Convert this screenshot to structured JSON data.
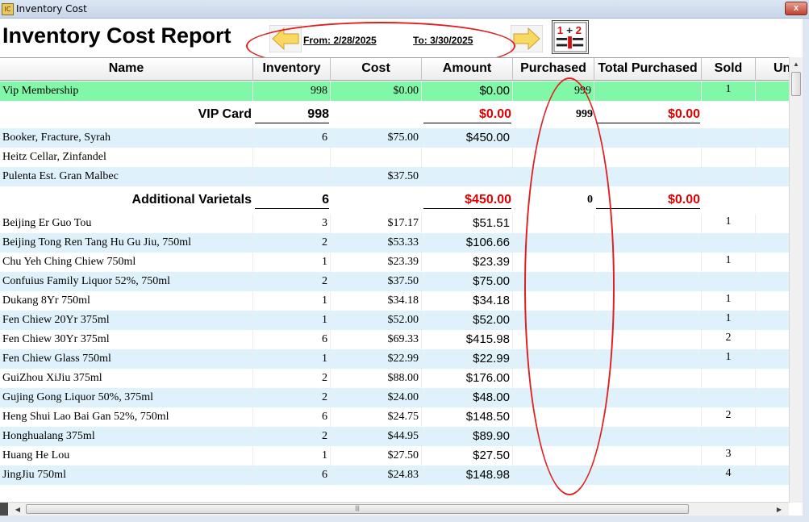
{
  "window": {
    "title": "Inventory Cost",
    "close_label": "x",
    "app_icon_label": "IC"
  },
  "header": {
    "report_title": "Inventory Cost Report",
    "from_label": "From: 2/28/2025",
    "to_label": "To: 3/30/2025",
    "report_icon": "calculator-report-icon"
  },
  "colors": {
    "green_row": "#80f8a8",
    "blue_row": "#dff2fc",
    "red_total": "#e00000",
    "annotation": "#e02020"
  },
  "columns": [
    "Name",
    "Inventory",
    "Cost",
    "Amount",
    "Purchased",
    "Total Purchased",
    "Sold",
    "Un"
  ],
  "rows": [
    {
      "type": "item",
      "style": "green",
      "name": "Vip Membership",
      "inventory": "998",
      "cost": "$0.00",
      "amount": "$0.00",
      "purchased": "999",
      "total_purchased": "",
      "sold": "1"
    },
    {
      "type": "subtotal",
      "name": "VIP Card",
      "inventory": "998",
      "amount": "$0.00",
      "purchased": "999",
      "total_purchased": "$0.00"
    },
    {
      "type": "item",
      "style": "blue",
      "name": "Booker, Fracture, Syrah",
      "inventory": "6",
      "cost": "$75.00",
      "amount": "$450.00",
      "purchased": "",
      "total_purchased": "",
      "sold": ""
    },
    {
      "type": "item",
      "style": "white",
      "name": "Heitz Cellar, Zinfandel",
      "inventory": "",
      "cost": "",
      "amount": "",
      "purchased": "",
      "total_purchased": "",
      "sold": ""
    },
    {
      "type": "item",
      "style": "blue",
      "name": "Pulenta Est. Gran Malbec",
      "inventory": "",
      "cost": "$37.50",
      "amount": "",
      "purchased": "",
      "total_purchased": "",
      "sold": ""
    },
    {
      "type": "subtotal",
      "name": "Additional Varietals",
      "inventory": "6",
      "amount": "$450.00",
      "purchased": "0",
      "total_purchased": "$0.00"
    },
    {
      "type": "item",
      "style": "white",
      "name": "Beijing Er Guo Tou",
      "inventory": "3",
      "cost": "$17.17",
      "amount": "$51.51",
      "purchased": "",
      "total_purchased": "",
      "sold": "1"
    },
    {
      "type": "item",
      "style": "blue",
      "name": "Beijing Tong Ren Tang Hu Gu Jiu, 750ml",
      "inventory": "2",
      "cost": "$53.33",
      "amount": "$106.66",
      "purchased": "",
      "total_purchased": "",
      "sold": ""
    },
    {
      "type": "item",
      "style": "white",
      "name": "Chu Yeh Ching Chiew 750ml",
      "inventory": "1",
      "cost": "$23.39",
      "amount": "$23.39",
      "purchased": "",
      "total_purchased": "",
      "sold": "1"
    },
    {
      "type": "item",
      "style": "blue",
      "name": "Confuius Family Liquor 52%, 750ml",
      "inventory": "2",
      "cost": "$37.50",
      "amount": "$75.00",
      "purchased": "",
      "total_purchased": "",
      "sold": ""
    },
    {
      "type": "item",
      "style": "white",
      "name": "Dukang 8Yr 750ml",
      "inventory": "1",
      "cost": "$34.18",
      "amount": "$34.18",
      "purchased": "",
      "total_purchased": "",
      "sold": "1"
    },
    {
      "type": "item",
      "style": "blue",
      "name": "Fen Chiew 20Yr 375ml",
      "inventory": "1",
      "cost": "$52.00",
      "amount": "$52.00",
      "purchased": "",
      "total_purchased": "",
      "sold": "1"
    },
    {
      "type": "item",
      "style": "white",
      "name": "Fen Chiew 30Yr 375ml",
      "inventory": "6",
      "cost": "$69.33",
      "amount": "$415.98",
      "purchased": "",
      "total_purchased": "",
      "sold": "2"
    },
    {
      "type": "item",
      "style": "blue",
      "name": "Fen Chiew Glass 750ml",
      "inventory": "1",
      "cost": "$22.99",
      "amount": "$22.99",
      "purchased": "",
      "total_purchased": "",
      "sold": "1"
    },
    {
      "type": "item",
      "style": "white",
      "name": "GuiZhou XiJiu 375ml",
      "inventory": "2",
      "cost": "$88.00",
      "amount": "$176.00",
      "purchased": "",
      "total_purchased": "",
      "sold": ""
    },
    {
      "type": "item",
      "style": "blue",
      "name": "Gujing Gong Liquor 50%, 375ml",
      "inventory": "2",
      "cost": "$24.00",
      "amount": "$48.00",
      "purchased": "",
      "total_purchased": "",
      "sold": ""
    },
    {
      "type": "item",
      "style": "white",
      "name": "Heng Shui Lao Bai Gan 52%, 750ml",
      "inventory": "6",
      "cost": "$24.75",
      "amount": "$148.50",
      "purchased": "",
      "total_purchased": "",
      "sold": "2"
    },
    {
      "type": "item",
      "style": "blue",
      "name": "Honghualang 375ml",
      "inventory": "2",
      "cost": "$44.95",
      "amount": "$89.90",
      "purchased": "",
      "total_purchased": "",
      "sold": ""
    },
    {
      "type": "item",
      "style": "white",
      "name": "Huang He Lou",
      "inventory": "1",
      "cost": "$27.50",
      "amount": "$27.50",
      "purchased": "",
      "total_purchased": "",
      "sold": "3"
    },
    {
      "type": "item",
      "style": "blue",
      "name": "JingJiu 750ml",
      "inventory": "6",
      "cost": "$24.83",
      "amount": "$148.98",
      "purchased": "",
      "total_purchased": "",
      "sold": "4"
    }
  ]
}
